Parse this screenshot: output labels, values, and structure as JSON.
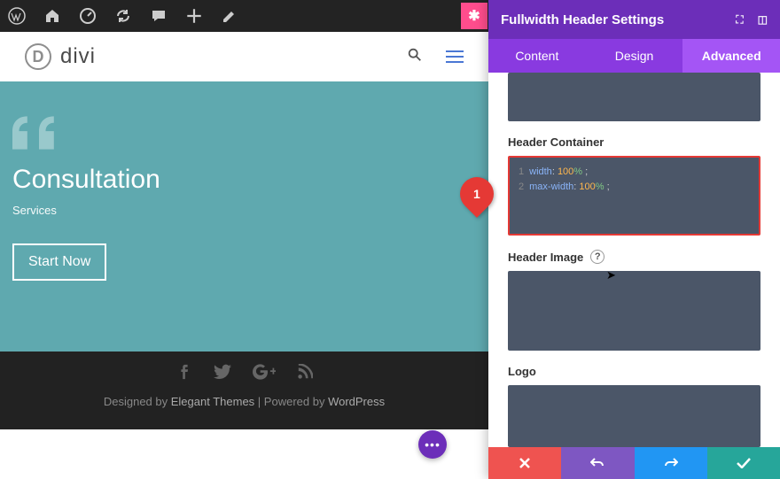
{
  "adminbar": {
    "save_glyph": "✱"
  },
  "site": {
    "logo_letter": "D",
    "logo_text": "divi"
  },
  "hero": {
    "title": "Consultation",
    "subtitle": "Services",
    "cta": "Start Now"
  },
  "footer": {
    "designed_by_prefix": "Designed by ",
    "designed_by": "Elegant Themes",
    "separator": " | ",
    "powered_by_prefix": "Powered by ",
    "powered_by": "WordPress"
  },
  "panel": {
    "title": "Fullwidth Header Settings",
    "tabs": {
      "content": "Content",
      "design": "Design",
      "advanced": "Advanced"
    },
    "fields": {
      "header_container": {
        "label": "Header Container",
        "code": [
          {
            "n": "1",
            "prop": "width",
            "val": "100",
            "unit": "%"
          },
          {
            "n": "2",
            "prop": "max-width",
            "val": "100",
            "unit": "%"
          }
        ]
      },
      "header_image": {
        "label": "Header Image",
        "help": "?"
      },
      "logo": {
        "label": "Logo"
      }
    }
  },
  "callout": {
    "num": "1"
  }
}
